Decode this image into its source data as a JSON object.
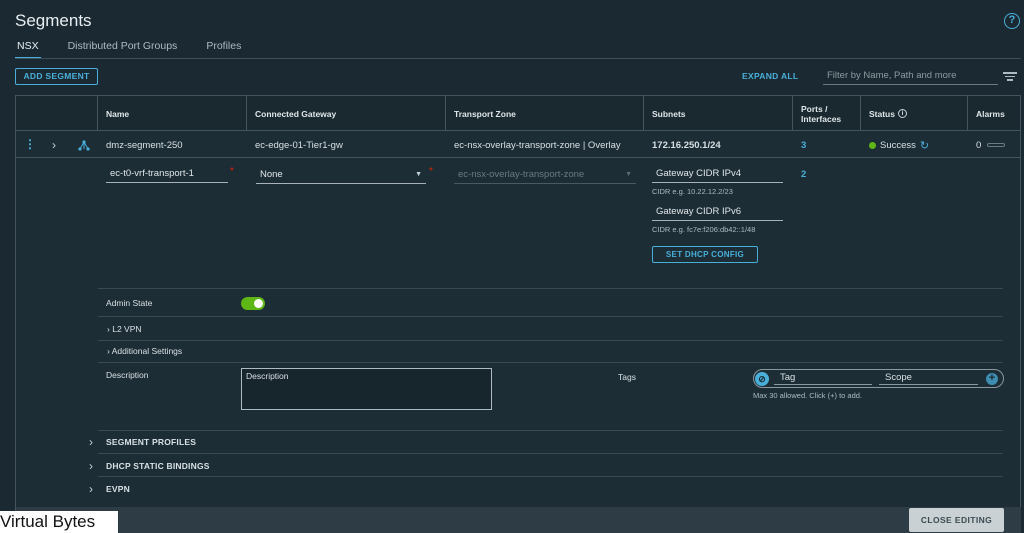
{
  "page": {
    "title": "Segments",
    "help": "?"
  },
  "tabs": [
    "NSX",
    "Distributed Port Groups",
    "Profiles"
  ],
  "toolbar": {
    "add_label": "ADD SEGMENT",
    "expand_label": "EXPAND ALL",
    "filter_placeholder": "Filter by Name, Path and more"
  },
  "table": {
    "headers": {
      "name": "Name",
      "gateway": "Connected Gateway",
      "zone": "Transport Zone",
      "subnets": "Subnets",
      "ports": "Ports / Interfaces",
      "status": "Status",
      "alarms": "Alarms"
    },
    "row": {
      "name": "dmz-segment-250",
      "gateway": "ec-edge-01-Tier1-gw",
      "zone": "ec-nsx-overlay-transport-zone | Overlay",
      "subnet": "172.16.250.1/24",
      "ports": "3",
      "status": "Success",
      "alarms": "0"
    }
  },
  "edit": {
    "name_value": "ec-t0-vrf-transport-1",
    "gateway_value": "None",
    "zone_value": "ec-nsx-overlay-transport-zone",
    "ipv4_placeholder": "Gateway CIDR IPv4",
    "ipv4_helper": "CIDR e.g. 10.22.12.2/23",
    "ipv6_placeholder": "Gateway CIDR IPv6",
    "ipv6_helper": "CIDR e.g. fc7e:f206:db42::1/48",
    "ports_value": "2",
    "dhcp_button": "SET DHCP CONFIG",
    "admin_state_label": "Admin State",
    "admin_state_on": true,
    "l2vpn": "L2 VPN",
    "additional": "Additional Settings",
    "description_label": "Description",
    "description_placeholder": "Description",
    "tags_label": "Tags",
    "tag_placeholder": "Tag",
    "scope_placeholder": "Scope",
    "tags_helper": "Max 30 allowed. Click (+) to add.",
    "sections": [
      "SEGMENT PROFILES",
      "DHCP STATIC BINDINGS",
      "EVPN"
    ]
  },
  "footer": {
    "close_label": "CLOSE EDITING"
  },
  "watermark": "Virtual Bytes",
  "colors": {
    "accent": "#49afd9",
    "success": "#5eb715",
    "required": "#e12200",
    "background": "#1b2a32"
  }
}
